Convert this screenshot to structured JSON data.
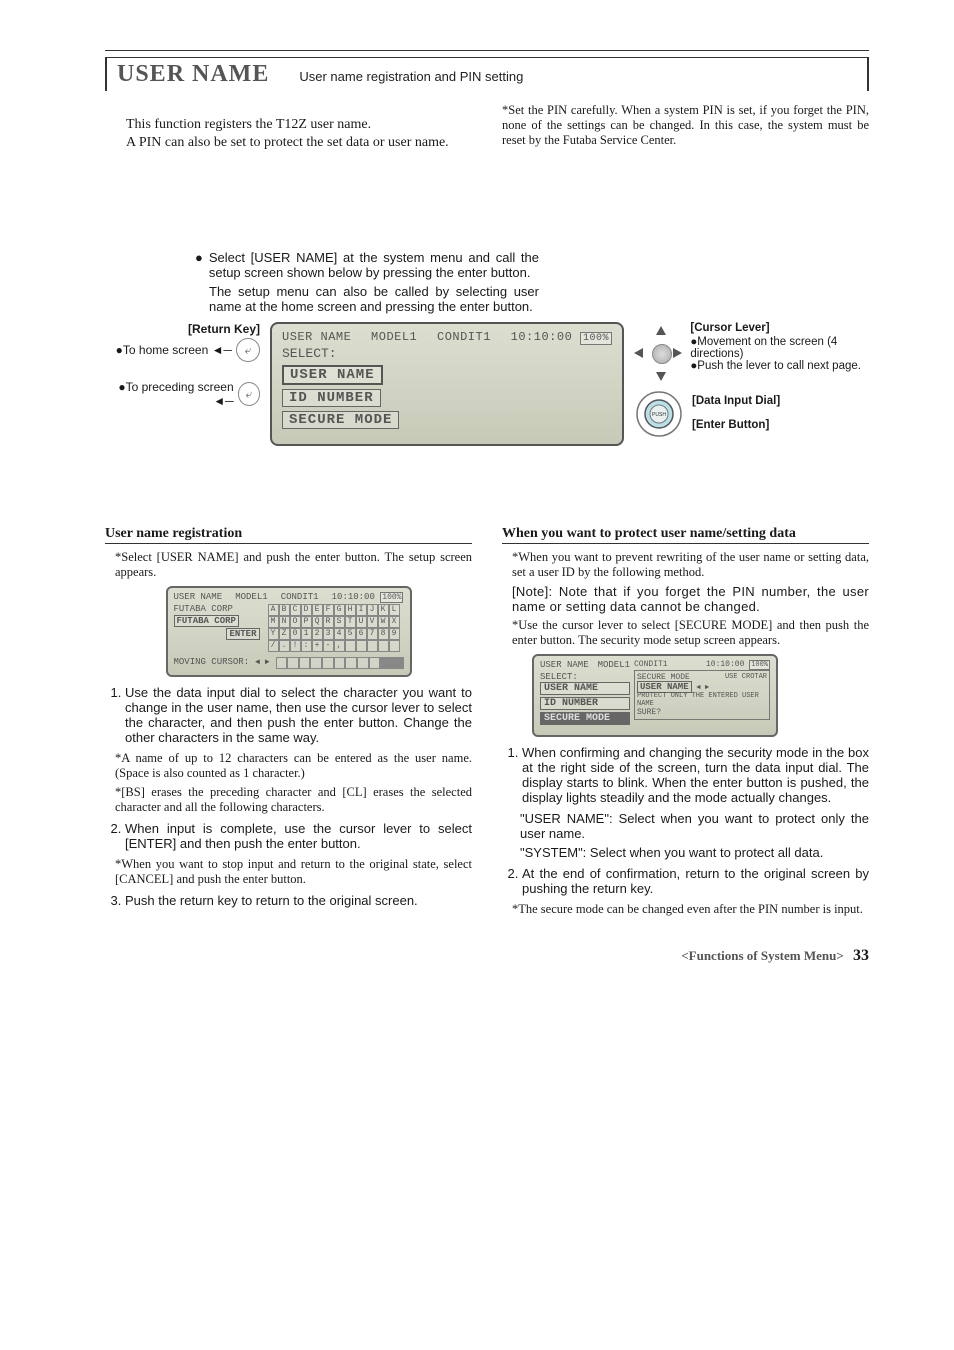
{
  "header": {
    "title": "USER NAME",
    "subtitle": "User name registration and PIN setting"
  },
  "intro": {
    "left_p1": "This function registers the T12Z user name.",
    "left_p2": "A PIN can also be set to protect the set data or user name.",
    "right_note": "*Set the PIN carefully. When a system PIN is set, if you forget the PIN, none of the settings can be changed. In this case, the system must be reset by the Futaba Service Center."
  },
  "mid": {
    "bullet1": "Select [USER NAME] at the system menu and call the setup screen shown below by pressing the enter button.",
    "bullet2": "The setup menu can also be called by selecting user name at the home screen and pressing the enter button.",
    "return_key": "[Return Key]",
    "to_home": "To home screen",
    "to_prec": "To preceding screen",
    "cursor_lever": "[Cursor Lever]",
    "cursor_desc1": "●Movement on the screen (4 directions)",
    "cursor_desc2": "●Push the lever to call next page.",
    "data_dial": "[Data Input Dial]",
    "enter_btn": "[Enter Button]",
    "push": "PUSH"
  },
  "lcd_main": {
    "title": "USER NAME",
    "model": "MODEL1",
    "condit": "CONDIT1",
    "time": "10:10:00",
    "batt": "100%",
    "select": "SELECT:",
    "items": [
      "USER NAME",
      "ID NUMBER",
      "SECURE MODE"
    ]
  },
  "lcd_reg": {
    "title": "USER NAME",
    "model": "MODEL1",
    "condit": "CONDIT1",
    "time": "10:10:00",
    "batt": "100%",
    "corp": "FUTABA CORP",
    "input": "FUTABA CORP",
    "enter": "ENTER",
    "moving": "MOVING CURSOR:",
    "row1": [
      "A",
      "B",
      "C",
      "D",
      "E",
      "F",
      "G",
      "H",
      "I",
      "J",
      "K",
      "L"
    ],
    "row2": [
      "M",
      "N",
      "O",
      "P",
      "Q",
      "R",
      "S",
      "T",
      "U",
      "V",
      "W",
      "X"
    ],
    "row3": [
      "Y",
      "Z",
      "0",
      "1",
      "2",
      "3",
      "4",
      "5",
      "6",
      "7",
      "8",
      "9"
    ],
    "row4": [
      "/",
      ".",
      "!",
      ":",
      "+",
      "-",
      ",",
      "",
      "",
      "",
      "",
      ""
    ]
  },
  "lcd_sec": {
    "title": "USER NAME",
    "model": "MODEL1",
    "condit": "CONDIT1",
    "time": "10:10:00",
    "batt": "100%",
    "select": "SELECT:",
    "items": [
      "USER NAME",
      "ID NUMBER",
      "SECURE MODE"
    ],
    "panel_title": "SECURE MODE",
    "panel_sel": "USER NAME",
    "panel_use": "USE CROTAR",
    "panel_msg": "PROTECT ONLY THE ENTERED USER NAME",
    "panel_sure": "SURE?"
  },
  "left_col": {
    "heading": "User name registration",
    "note1": "*Select [USER NAME] and push the enter button. The setup screen appears.",
    "step1": "Use the data input dial to select the character you want to change in the user name, then use the cursor lever to select the character, and then push the enter button. Change the other characters in the same way.",
    "note2": "*A name of up to 12 characters can be entered as the user name. (Space is also counted as 1 character.)",
    "note3": "*[BS] erases the preceding character and [CL] erases the selected character and all the following characters.",
    "step2": "When input is complete, use the cursor lever to select [ENTER] and then push the enter button.",
    "note4": "*When you want to stop input and return to the original state, select [CANCEL] and push the enter button.",
    "step3": "Push the return key to return to the original screen."
  },
  "right_col": {
    "heading": "When you want to protect user name/setting data",
    "note1": "*When you want to prevent rewriting of the user name or setting data, set a user ID by the following method.",
    "note_block": "[Note]: Note that if you forget the PIN number, the user name or setting data cannot be changed.",
    "note2": "*Use the cursor lever to select [SECURE MODE] and then push the enter button. The security mode setup screen appears.",
    "step1": "When confirming and changing the security mode in the box at the right side of the screen, turn the data input dial. The display starts to blink. When the enter button is pushed, the display lights steadily and the mode actually changes.",
    "sub1": "\"USER NAME\": Select when you want to protect only the user name.",
    "sub2": "\"SYSTEM\": Select when you want to protect all data.",
    "step2": "At the end of confirmation, return to the original screen by pushing the return key.",
    "note3": "*The secure mode can be changed even after the PIN number is input."
  },
  "footer": {
    "section": "<Functions of System Menu>",
    "page": "33"
  }
}
